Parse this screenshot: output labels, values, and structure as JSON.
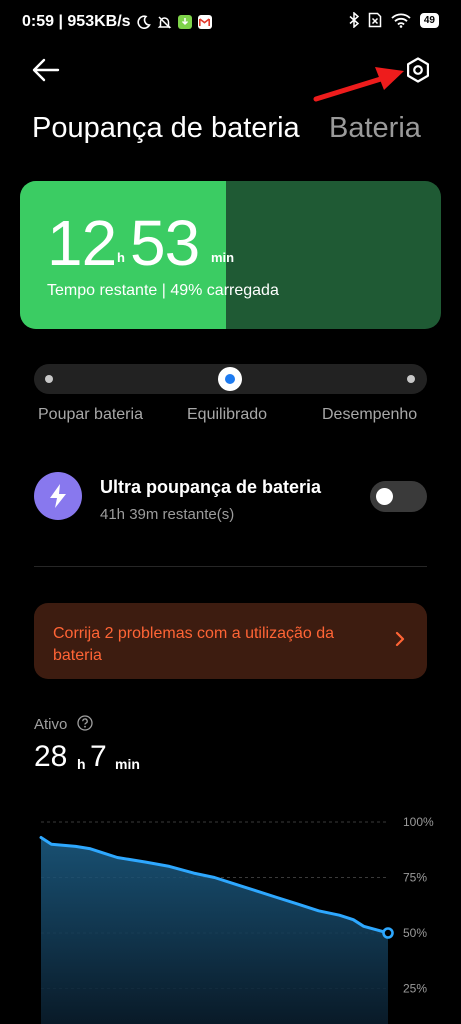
{
  "status_bar": {
    "time_speed": "0:59 | 953KB/s",
    "battery_level": "49",
    "icons": [
      "moon-icon",
      "bell-off-icon",
      "download-app-icon",
      "gmail-icon",
      "bluetooth-icon",
      "sim-off-icon",
      "wifi-icon",
      "battery-icon"
    ]
  },
  "header": {
    "title": "Poupança de bateria",
    "alt_tab": "Bateria"
  },
  "battery_card": {
    "hours": "12",
    "hours_unit": "h",
    "minutes": "53",
    "minutes_unit": "min",
    "subtitle": "Tempo restante | 49% carregada",
    "charge_fraction": 0.49,
    "fill_color": "#3bcc63",
    "empty_color": "#1f5a34"
  },
  "mode_slider": {
    "options": [
      "Poupar bateria",
      "Equilibrado",
      "Desempenho"
    ],
    "selected": "Equilibrado",
    "accent": "#1e7bf0"
  },
  "ultra_saver": {
    "title": "Ultra poupança de bateria",
    "subtitle": "41h 39m restante(s)",
    "enabled": false,
    "icon_color": "#8878ee"
  },
  "alert": {
    "text": "Corrija 2 problemas com a utilização da bateria",
    "color": "#ff6435"
  },
  "active": {
    "label": "Ativo",
    "hours": "28",
    "hours_unit": "h",
    "minutes": "7",
    "minutes_unit": "min"
  },
  "chart_data": {
    "type": "area",
    "y_ticks": [
      "100%",
      "75%",
      "50%",
      "25%"
    ],
    "ylim": [
      0,
      100
    ],
    "line_color": "#2ea8ff",
    "x": [
      0,
      0.03,
      0.1,
      0.14,
      0.18,
      0.22,
      0.3,
      0.37,
      0.44,
      0.5,
      0.56,
      0.62,
      0.68,
      0.74,
      0.8,
      0.86,
      0.9,
      0.93,
      1.0
    ],
    "values": [
      93,
      90,
      89,
      88,
      86,
      84,
      82,
      80,
      77,
      75,
      72,
      69,
      66,
      63,
      60,
      58,
      56,
      53,
      50
    ]
  }
}
